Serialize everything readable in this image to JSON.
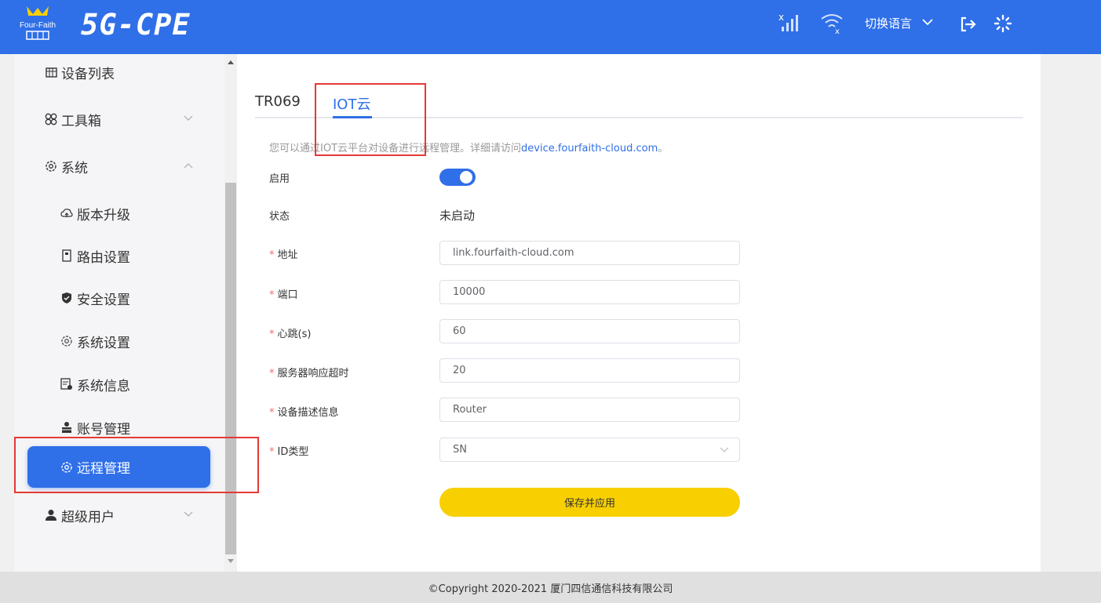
{
  "header": {
    "logo_text": "Four-Faith",
    "product_name": "5G-CPE",
    "language_label": "切换语言"
  },
  "sidebar": {
    "items": [
      {
        "label": "设备列表",
        "icon": "device-list-icon"
      },
      {
        "label": "工具箱",
        "icon": "toolbox-icon"
      },
      {
        "label": "系统",
        "icon": "system-gear-icon"
      },
      {
        "label": "版本升级",
        "icon": "cloud-upload-icon"
      },
      {
        "label": "路由设置",
        "icon": "router-icon"
      },
      {
        "label": "安全设置",
        "icon": "shield-icon"
      },
      {
        "label": "系统设置",
        "icon": "gear-icon"
      },
      {
        "label": "系统信息",
        "icon": "info-doc-icon"
      },
      {
        "label": "账号管理",
        "icon": "account-icon"
      },
      {
        "label": "远程管理",
        "icon": "gear-icon"
      },
      {
        "label": "超级用户",
        "icon": "user-icon"
      }
    ]
  },
  "tabs": [
    {
      "label": "TR069"
    },
    {
      "label": "IOT云"
    }
  ],
  "desc": {
    "prefix": "您可以通过IOT云平台对设备进行远程管理。详细请访问",
    "link": "device.fourfaith-cloud.com",
    "suffix": "。"
  },
  "form": {
    "enable_label": "启用",
    "status_label": "状态",
    "status_value": "未启动",
    "address_label": "地址",
    "address_value": "link.fourfaith-cloud.com",
    "port_label": "端口",
    "port_value": "10000",
    "heartbeat_label": "心跳(s)",
    "heartbeat_value": "60",
    "timeout_label": "服务器响应超时",
    "timeout_value": "20",
    "device_desc_label": "设备描述信息",
    "device_desc_value": "Router",
    "id_type_label": "ID类型",
    "id_type_value": "SN",
    "save_label": "保存并应用"
  },
  "footer": {
    "copyright": "©Copyright 2020-2021 厦门四信通信科技有限公司"
  },
  "colors": {
    "primary": "#2f6fe8",
    "save_button": "#f8cf00",
    "required_star": "#f56c6c",
    "highlight": "#e53935"
  }
}
